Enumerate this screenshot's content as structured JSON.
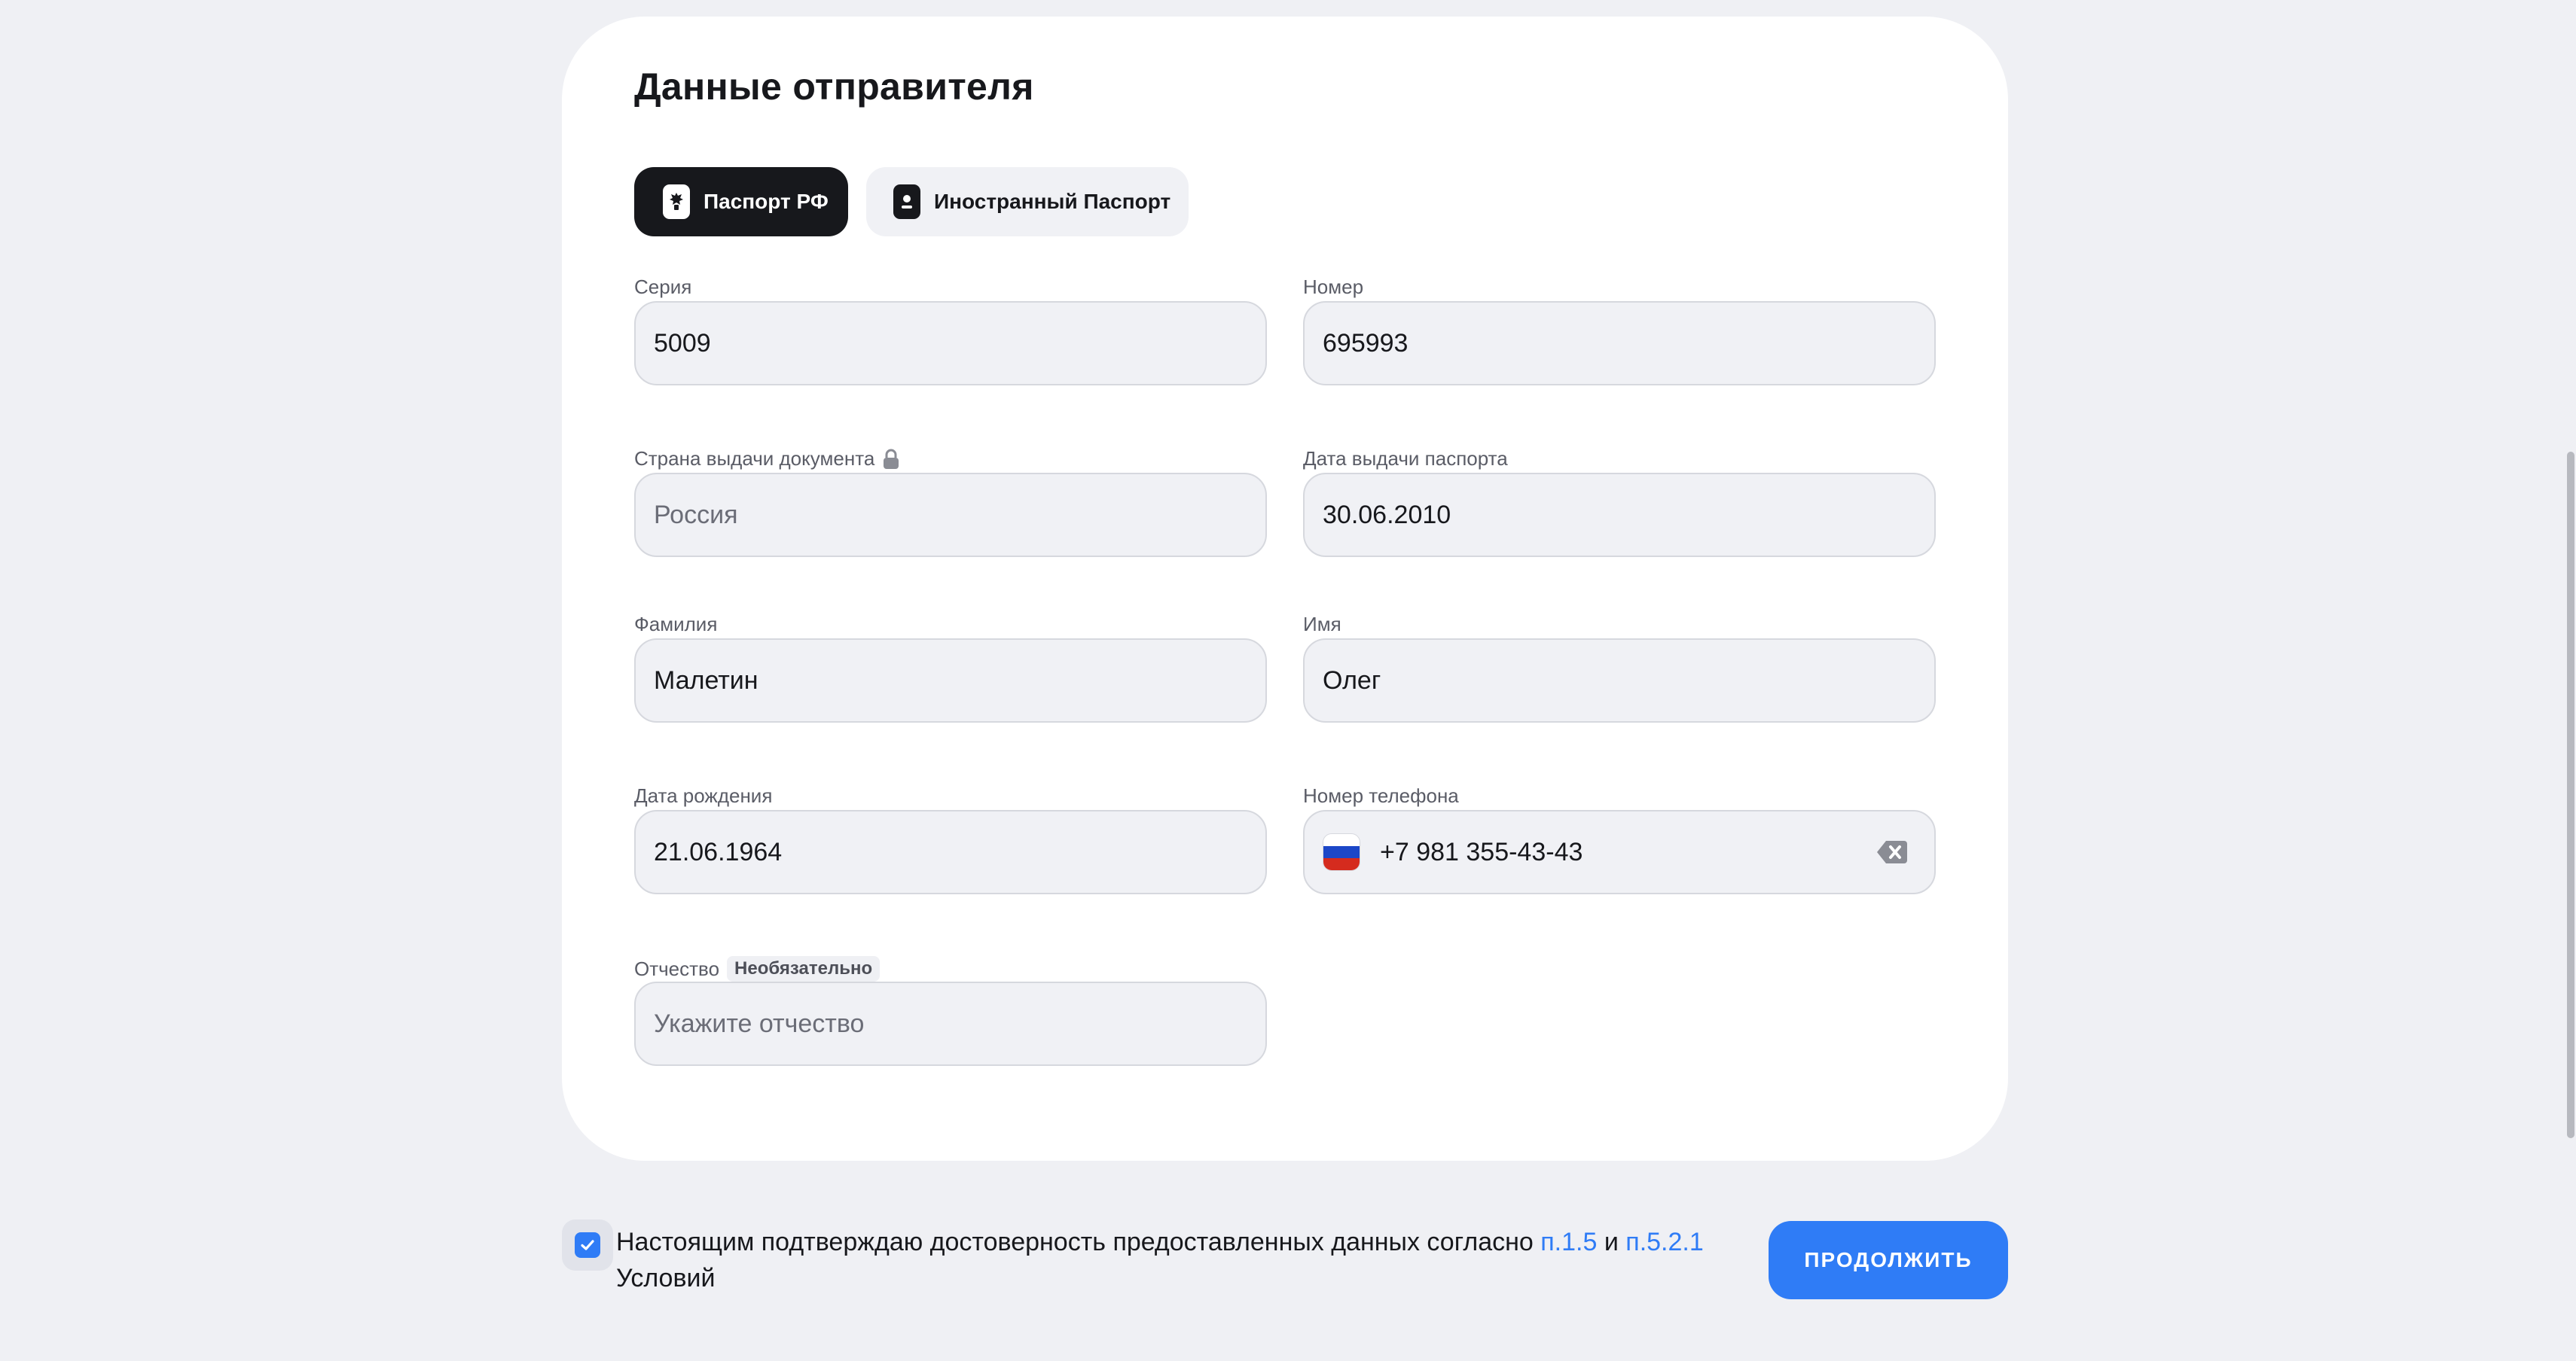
{
  "form": {
    "title": "Данные отправителя",
    "tabs": [
      {
        "label": "Паспорт РФ",
        "active": true
      },
      {
        "label": "Иностранный Паспорт",
        "active": false
      }
    ],
    "fields": {
      "series": {
        "label": "Серия",
        "value": "5009"
      },
      "number": {
        "label": "Номер",
        "value": "695993"
      },
      "country": {
        "label": "Страна выдачи документа",
        "placeholder": "Россия",
        "locked": true
      },
      "issue_date": {
        "label": "Дата выдачи паспорта",
        "value": "30.06.2010"
      },
      "last_name": {
        "label": "Фамилия",
        "value": "Малетин"
      },
      "first_name": {
        "label": "Имя",
        "value": "Олег"
      },
      "birth_date": {
        "label": "Дата рождения",
        "value": "21.06.1964"
      },
      "phone": {
        "label": "Номер телефона",
        "value": "+7 981 355-43-43",
        "flag_icon": "russia-flag-icon"
      },
      "patronymic": {
        "label": "Отчество",
        "optional_badge": "Необязательно",
        "placeholder": "Укажите отчество"
      }
    }
  },
  "consent": {
    "checked": true,
    "text_before": "Настоящим подтверждаю достоверность предоставленных данных согласно ",
    "link1": "п.1.5",
    "text_middle": " и ",
    "link2": "п.5.2.1",
    "text_after": " Условий"
  },
  "actions": {
    "continue_label": "ПРОДОЛЖИТЬ"
  },
  "colors": {
    "accent": "#2f7cf6",
    "page_bg": "#eff0f4",
    "input_bg": "#f0f1f5",
    "active_tab": "#17181c"
  }
}
